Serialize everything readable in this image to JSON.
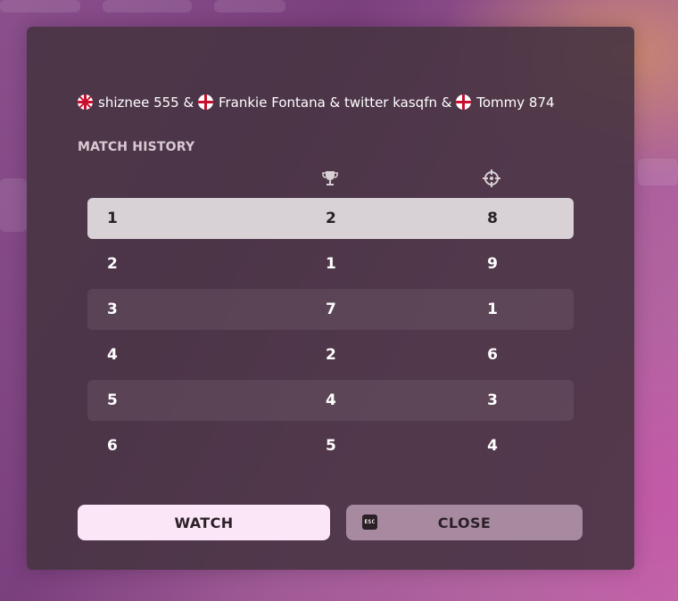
{
  "players": {
    "p1": "shiznee 555",
    "sep1": " & ",
    "p2": "Frankie Fontana & twitter kasqfn",
    "sep2": " & ",
    "p3": "Tommy 874",
    "flags": [
      "uk-flag-icon",
      "england-flag-icon",
      "england-flag-icon"
    ]
  },
  "section_title": "MATCH HISTORY",
  "columns": [
    "trophy-icon",
    "crosshair-icon"
  ],
  "rows": [
    {
      "match": "1",
      "placement": "2",
      "eliminations": "8"
    },
    {
      "match": "2",
      "placement": "1",
      "eliminations": "9"
    },
    {
      "match": "3",
      "placement": "7",
      "eliminations": "1"
    },
    {
      "match": "4",
      "placement": "2",
      "eliminations": "6"
    },
    {
      "match": "5",
      "placement": "4",
      "eliminations": "3"
    },
    {
      "match": "6",
      "placement": "5",
      "eliminations": "4"
    }
  ],
  "buttons": {
    "watch": "WATCH",
    "close": "CLOSE",
    "close_key": "ESC"
  }
}
